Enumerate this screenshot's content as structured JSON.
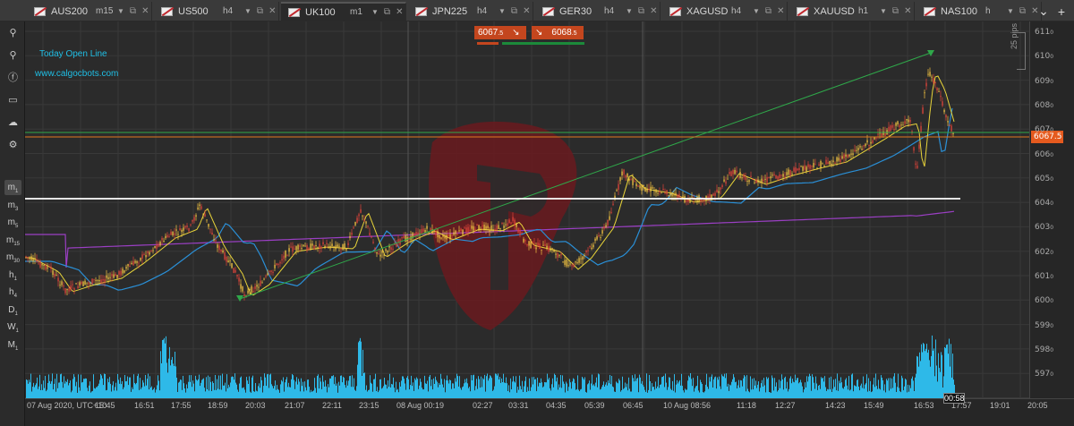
{
  "tabs": [
    {
      "symbol": "AUS200",
      "timeframe": "m15",
      "active": false
    },
    {
      "symbol": "US500",
      "timeframe": "h4",
      "active": false
    },
    {
      "symbol": "UK100",
      "timeframe": "m1",
      "active": true
    },
    {
      "symbol": "JPN225",
      "timeframe": "h4",
      "active": false
    },
    {
      "symbol": "GER30",
      "timeframe": "h4",
      "active": false
    },
    {
      "symbol": "XAGUSD",
      "timeframe": "h4",
      "active": false
    },
    {
      "symbol": "XAUUSD",
      "timeframe": "h1",
      "active": false
    },
    {
      "symbol": "NAS100",
      "timeframe": "h",
      "active": false
    }
  ],
  "tabbar_controls": {
    "chevron": "⌄",
    "add": "+"
  },
  "toolbar": {
    "icons": [
      "zoom-icon",
      "zoom-out-icon",
      "facebook-icon",
      "chat-icon",
      "weather-icon",
      "settings-icon"
    ],
    "icon_glyphs": [
      "⚲",
      "⚲",
      "ⓕ",
      "▭",
      "☁",
      "⚙"
    ],
    "timeframes": [
      {
        "main": "m",
        "sub": "1",
        "active": true
      },
      {
        "main": "m",
        "sub": "3",
        "active": false
      },
      {
        "main": "m",
        "sub": "5",
        "active": false
      },
      {
        "main": "m",
        "sub": "15",
        "active": false
      },
      {
        "main": "m",
        "sub": "30",
        "active": false
      },
      {
        "main": "h",
        "sub": "1",
        "active": false
      },
      {
        "main": "h",
        "sub": "4",
        "active": false
      },
      {
        "main": "D",
        "sub": "1",
        "active": false
      },
      {
        "main": "W",
        "sub": "1",
        "active": false
      },
      {
        "main": "M",
        "sub": "1",
        "active": false
      }
    ]
  },
  "chart": {
    "annotation_today_open": "Today Open Line",
    "annotation_site": "www.calgocbots.com",
    "sell_price": {
      "main": "6067",
      "frac": ".5",
      "icon": "↘"
    },
    "buy_price": {
      "main": "6068",
      "frac": ".5",
      "icon": "↘"
    },
    "current_price": "6067.5",
    "pips_label": "25 pips",
    "countdown": "00:58",
    "colors": {
      "background": "#2b2b2b",
      "candle_up": "#f5c542",
      "candle_down": "#e0443a",
      "ma_fast": "#e8d43a",
      "ma_slow": "#2a8fd6",
      "ma_long": "#9b3fc4",
      "trendline": "#2fa84a",
      "today_open_line": "#e07a1f",
      "level_line": "#ffffff",
      "volume": "#2eb9e8",
      "watermark": "#6a1a1e"
    }
  },
  "price_axis": {
    "ticks": [
      {
        "main": "611",
        "frac": "0"
      },
      {
        "main": "610",
        "frac": "0"
      },
      {
        "main": "609",
        "frac": "0"
      },
      {
        "main": "608",
        "frac": "0"
      },
      {
        "main": "607",
        "frac": "0"
      },
      {
        "main": "606",
        "frac": "0"
      },
      {
        "main": "605",
        "frac": "0"
      },
      {
        "main": "604",
        "frac": "0"
      },
      {
        "main": "603",
        "frac": "0"
      },
      {
        "main": "602",
        "frac": "0"
      },
      {
        "main": "601",
        "frac": "0"
      },
      {
        "main": "600",
        "frac": "0"
      },
      {
        "main": "599",
        "frac": "0"
      },
      {
        "main": "598",
        "frac": "0"
      },
      {
        "main": "597",
        "frac": "0"
      }
    ]
  },
  "time_axis": {
    "labels": [
      "07 Aug 2020, UTC+10",
      "15:45",
      "16:51",
      "17:55",
      "18:59",
      "20:03",
      "21:07",
      "22:11",
      "23:15",
      "08 Aug 00:19",
      "02:27",
      "03:31",
      "04:35",
      "05:39",
      "06:45",
      "10 Aug 08:56",
      "11:18",
      "12:27",
      "14:23",
      "15:49",
      "16:53",
      "17:57",
      "19:01",
      "20:05"
    ]
  }
}
